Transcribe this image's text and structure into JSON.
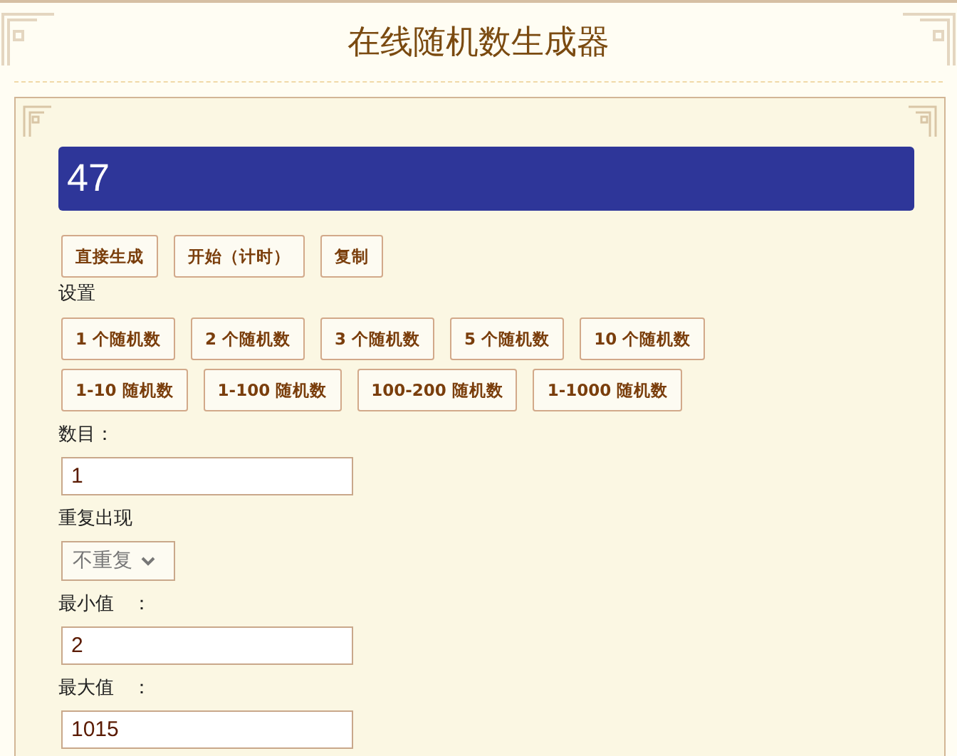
{
  "title": "在线随机数生成器",
  "result": "47",
  "actions": [
    "直接生成",
    "开始（计时）",
    "复制"
  ],
  "settings_label": "设置",
  "presets": [
    [
      "1 个随机数",
      "2 个随机数",
      "3 个随机数",
      "5 个随机数",
      "10 个随机数"
    ],
    [
      "1-10 随机数",
      "1-100 随机数",
      "100-200 随机数",
      "1-1000 随机数"
    ]
  ],
  "fields": [
    {
      "kind": "input",
      "label": "数目：",
      "value": "1"
    },
    {
      "kind": "select",
      "label": "重复出现",
      "value": "不重复"
    },
    {
      "kind": "input",
      "label": "最小值　：",
      "value": "2"
    },
    {
      "kind": "input",
      "label": "最大值　：",
      "value": "1015"
    }
  ]
}
